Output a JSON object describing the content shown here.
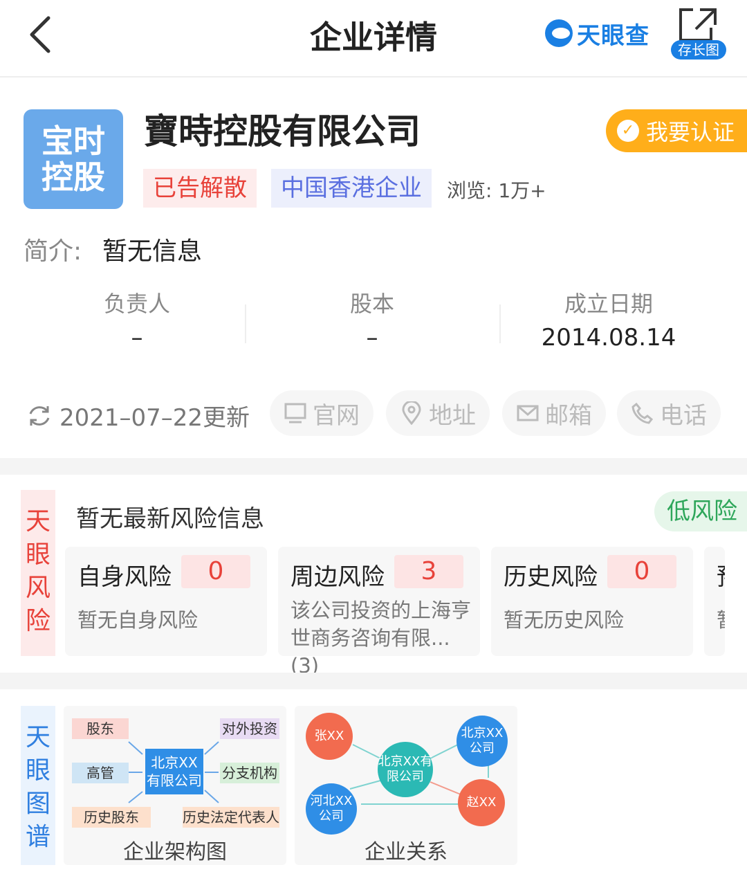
{
  "header": {
    "title": "企业详情",
    "brand": "天眼查",
    "share_label": "存长图"
  },
  "company": {
    "logo_line1": "宝时",
    "logo_line2": "控股",
    "name": "寶時控股有限公司",
    "verify_label": "我要认证",
    "tags": [
      "已告解散",
      "中国香港企业"
    ],
    "views": "浏览: 1万+",
    "intro_label": "简介:",
    "intro_value": "暂无信息",
    "stats": [
      {
        "label": "负责人",
        "value": "–"
      },
      {
        "label": "股本",
        "value": "–"
      },
      {
        "label": "成立日期",
        "value": "2014.08.14"
      }
    ],
    "updated": "2021–07–22更新",
    "actions": [
      "官网",
      "地址",
      "邮箱",
      "电话"
    ]
  },
  "risk": {
    "label": "天眼风险",
    "title": "暂无最新风险信息",
    "level": "低风险",
    "cards": [
      {
        "name": "自身风险",
        "count": "0",
        "desc": "暂无自身风险"
      },
      {
        "name": "周边风险",
        "count": "3",
        "desc": "该公司投资的上海亨世商务咨询有限...(3)"
      },
      {
        "name": "历史风险",
        "count": "0",
        "desc": "暂无历史风险"
      }
    ],
    "partial_card": {
      "name": "预",
      "desc": "暂"
    }
  },
  "map": {
    "label": "天眼图谱",
    "structure": {
      "caption": "企业架构图",
      "center": "北京XX有限公司",
      "nodes": [
        "股东",
        "高管",
        "历史股东",
        "对外投资",
        "分支机构",
        "历史法定代表人"
      ]
    },
    "relation": {
      "caption": "企业关系",
      "nodes": [
        "张XX",
        "北京XX有限公司",
        "北京XX公司",
        "河北XX公司",
        "赵XX"
      ]
    }
  },
  "colors": {
    "brand": "#1a7fe3",
    "risk_red": "#e8423a",
    "low_risk_green": "#2ea65a",
    "verify_orange": "#ffae1a"
  }
}
